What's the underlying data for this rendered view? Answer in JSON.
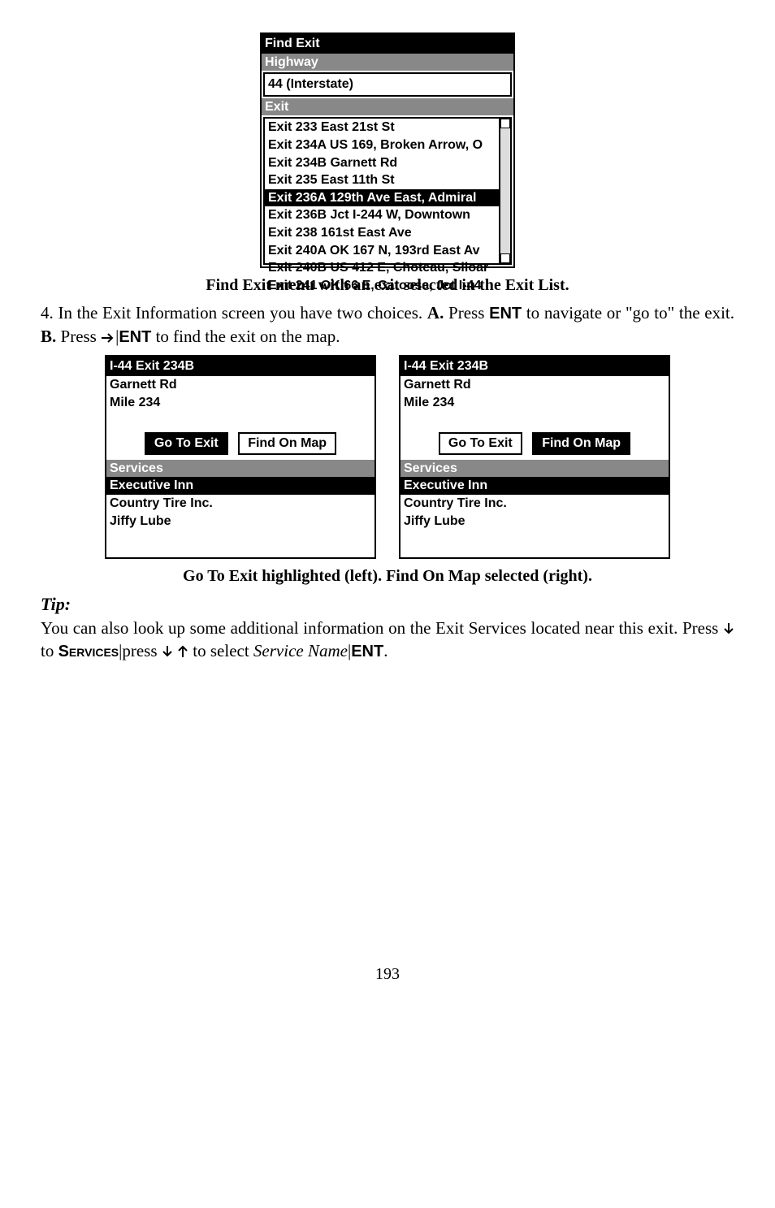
{
  "fig1": {
    "title": "Find Exit",
    "highway_label": "Highway",
    "highway_value": "44 (Interstate)",
    "exit_label": "Exit",
    "items": [
      "Exit 233 East 21st St",
      "Exit 234A US 169, Broken Arrow, O",
      "Exit 234B Garnett Rd",
      "Exit 235 East 11th St",
      "Exit 236A 129th Ave East, Admiral",
      "Exit 236B Jct I-244 W, Downtown",
      "Exit 238 161st East Ave",
      "Exit 240A OK 167 N, 193rd East Av",
      "Exit 240B US 412 E, Choteau, Siloar",
      "Exit 241 OK 66 E, Catoosa, Jct I-44"
    ],
    "selected_index": 4
  },
  "caption1": "Find Exit menu with an exit selected in the Exit List.",
  "para1_a": "4. In the Exit Information screen you have two choices. ",
  "para1_b": "A.",
  "para1_c": " Press ",
  "para1_ent": "ENT",
  "para1_d": " to navigate or \"go to\" the exit. ",
  "para1_e": "B.",
  "para1_f": " Press ",
  "para1_g": " to find the exit on the map.",
  "fig2": {
    "title": "I-44 Exit 234B",
    "line1": "Garnett Rd",
    "line2": "Mile 234",
    "btn_go": "Go To Exit",
    "btn_find": "Find On Map",
    "services_label": "Services",
    "svc_selected": "Executive Inn",
    "svc2": "Country Tire Inc.",
    "svc3": "Jiffy Lube"
  },
  "caption2": "Go To Exit highlighted (left). Find On Map selected (right).",
  "tip_label": "Tip:",
  "tip_a": "You can also look up some additional information on the Exit Services located near this exit. Press ",
  "tip_b": " to ",
  "tip_services": "Services",
  "tip_c": "|press ",
  "tip_d": " to select ",
  "tip_e": "Service Name",
  "tip_f": "|",
  "tip_ent": "ENT",
  "tip_g": ".",
  "page_number": "193"
}
